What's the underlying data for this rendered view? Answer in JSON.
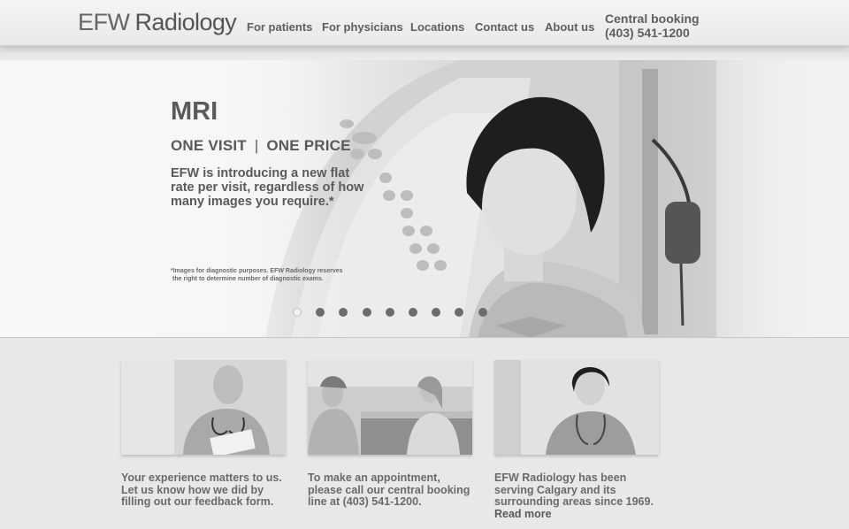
{
  "header": {
    "logo_mark": "EFW",
    "logo_word": "Radiology",
    "nav": [
      {
        "label": "For patients"
      },
      {
        "label": "For physicians"
      },
      {
        "label": "Locations"
      },
      {
        "label": "Contact us"
      },
      {
        "label": "About us"
      }
    ],
    "booking_label": "Central booking",
    "booking_phone": "(403) 541-1200"
  },
  "hero": {
    "title": "MRI",
    "subtitle_left": "ONE VISIT",
    "subtitle_sep": "|",
    "subtitle_right": "ONE PRICE",
    "body": "EFW is introducing a new flat rate per visit, regardless of how many images you require.*",
    "note_line1": "*Images for diagnostic purposes. EFW Radiology reserves",
    "note_line2": "the right to determine number of diagnostic exams.",
    "slide_count": 9,
    "active_slide": 1
  },
  "cards": [
    {
      "text": "Your experience matters to us. Let us know how we did by filling out our feedback form.",
      "link": ""
    },
    {
      "text": "To make an appointment, please call our central booking line at (403) 541-1200.",
      "link": ""
    },
    {
      "text": "EFW Radiology has been serving Calgary and its surrounding areas since 1969.",
      "link": "Read more"
    }
  ]
}
